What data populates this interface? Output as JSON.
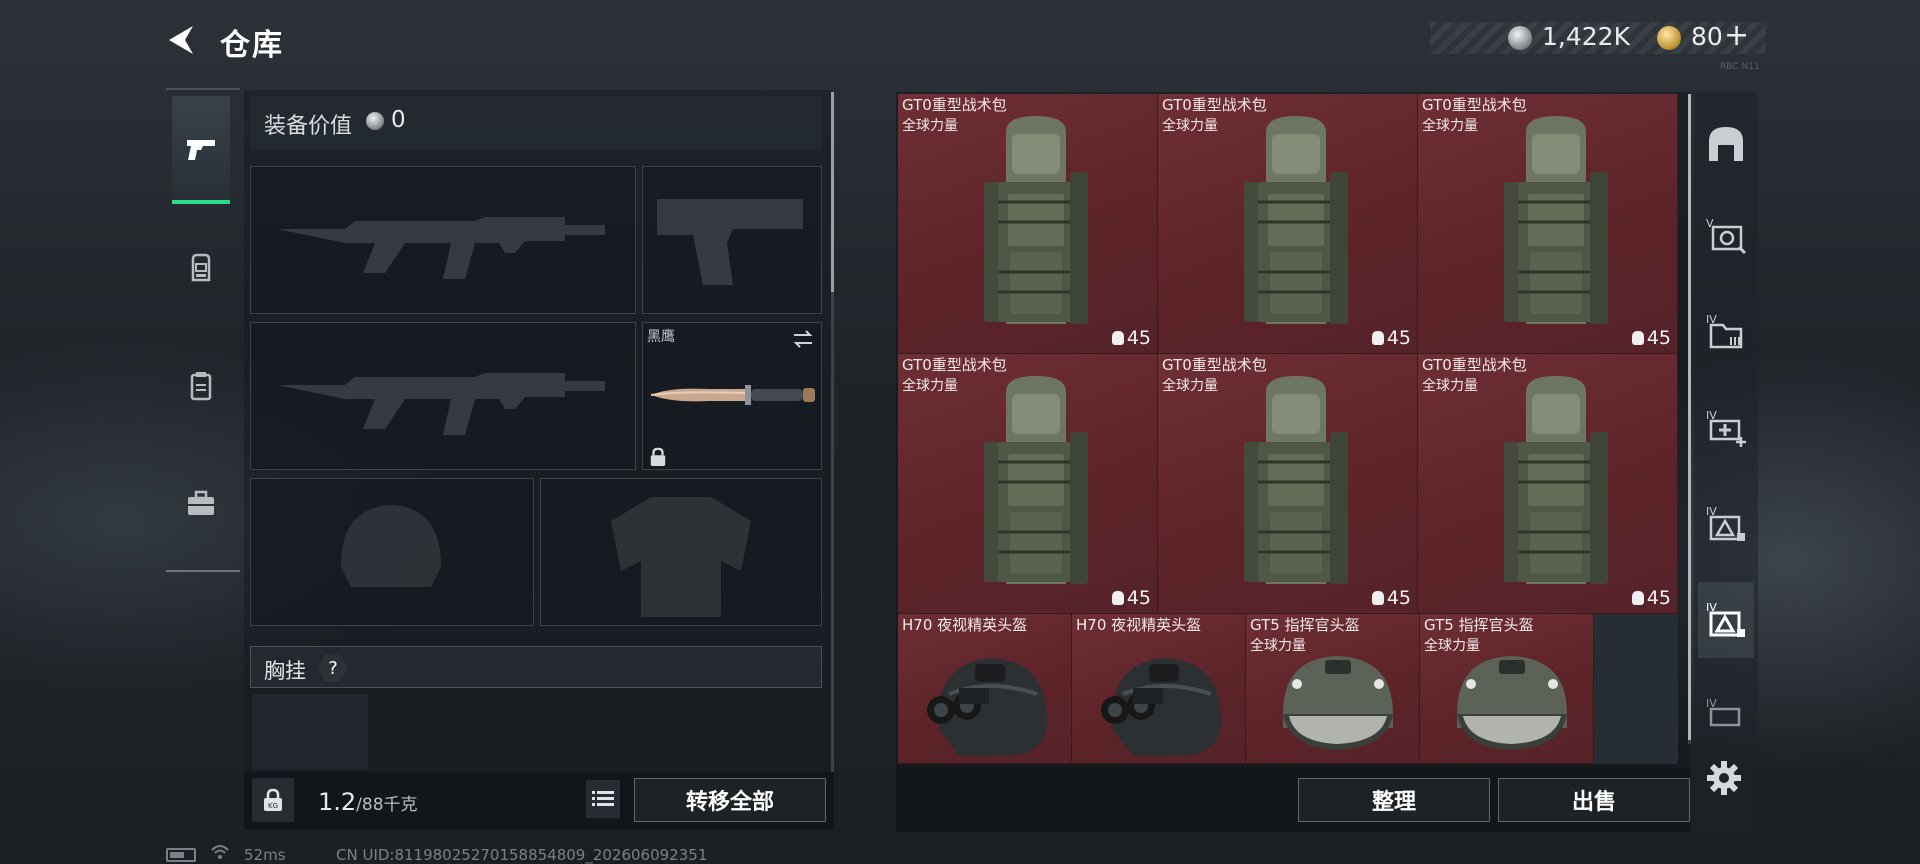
{
  "header": {
    "title": "仓库",
    "back_icon": "back-arrow-icon",
    "currencies": {
      "silver_amount": "1,422K",
      "gold_amount": "80",
      "plus_label": "+"
    },
    "corner_code": "RBC N11"
  },
  "tabs": [
    {
      "name": "weapons",
      "icon": "pistol-icon",
      "active": true
    },
    {
      "name": "backpack",
      "icon": "backpack-icon",
      "active": false
    },
    {
      "name": "container",
      "icon": "container-icon",
      "active": false
    },
    {
      "name": "briefcase",
      "icon": "briefcase-icon",
      "active": false
    }
  ],
  "loadout": {
    "equip_value_label": "装备价值",
    "equip_value": "0",
    "melee_name": "黑鹰",
    "chest_label": "胸挂",
    "help_label": "?",
    "weight_current": "1.2",
    "weight_max": "/88千克",
    "transfer_all_label": "转移全部"
  },
  "grid": {
    "items": [
      {
        "name": "GT0重型战术包",
        "sub": "全球力量",
        "capacity": "45",
        "type": "backpack"
      },
      {
        "name": "GT0重型战术包",
        "sub": "全球力量",
        "capacity": "45",
        "type": "backpack"
      },
      {
        "name": "GT0重型战术包",
        "sub": "全球力量",
        "capacity": "45",
        "type": "backpack"
      },
      {
        "name": "GT0重型战术包",
        "sub": "全球力量",
        "capacity": "45",
        "type": "backpack"
      },
      {
        "name": "GT0重型战术包",
        "sub": "全球力量",
        "capacity": "45",
        "type": "backpack"
      },
      {
        "name": "GT0重型战术包",
        "sub": "全球力量",
        "capacity": "45",
        "type": "backpack"
      },
      {
        "name": "H70 夜视精英头盔",
        "sub": "",
        "capacity": "",
        "type": "nv-helmet"
      },
      {
        "name": "H70 夜视精英头盔",
        "sub": "",
        "capacity": "",
        "type": "nv-helmet"
      },
      {
        "name": "GT5 指挥官头盔",
        "sub": "全球力量",
        "capacity": "",
        "type": "cmd-helmet"
      },
      {
        "name": "GT5 指挥官头盔",
        "sub": "全球力量",
        "capacity": "",
        "type": "cmd-helmet"
      }
    ],
    "sort_label": "整理",
    "sell_label": "出售"
  },
  "rail": [
    {
      "icon": "all-items-icon",
      "active": false
    },
    {
      "icon": "tier5-safe-icon",
      "active": false
    },
    {
      "icon": "tier4-folder-icon",
      "active": false
    },
    {
      "icon": "tier4-medkit-icon",
      "active": false
    },
    {
      "icon": "tier4-weapon-icon",
      "active": false
    },
    {
      "icon": "tier4-triangle-icon",
      "active": true
    },
    {
      "icon": "tier4-misc-icon",
      "active": false
    }
  ],
  "status": {
    "ping": "52ms",
    "uid": "CN UID:81198025270158854809_202606092351"
  },
  "colors": {
    "accent_green": "#2fd98a",
    "item_rarity_red": "#6e2f35"
  }
}
